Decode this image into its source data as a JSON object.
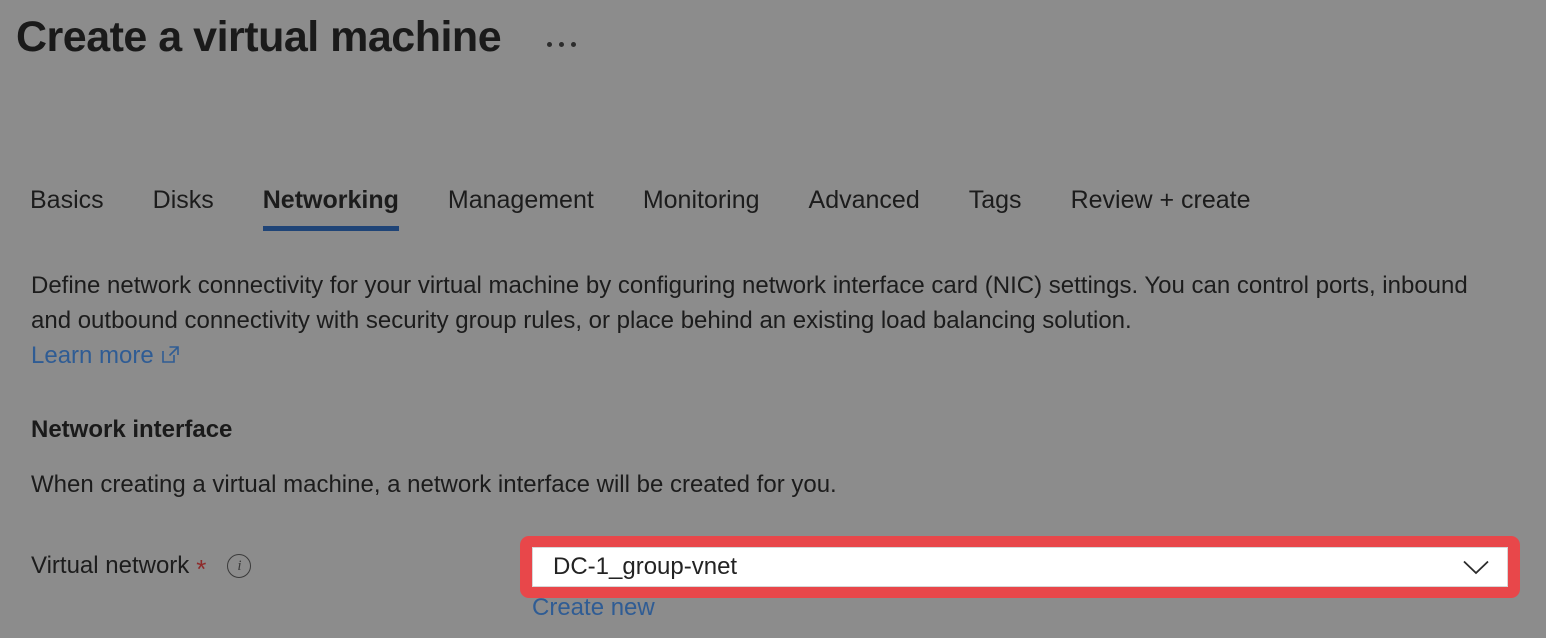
{
  "header": {
    "title": "Create a virtual machine",
    "more_menu": "...",
    "more_menu_name": "more-options-icon"
  },
  "tabs": [
    {
      "label": "Basics",
      "active": false
    },
    {
      "label": "Disks",
      "active": false
    },
    {
      "label": "Networking",
      "active": true
    },
    {
      "label": "Management",
      "active": false
    },
    {
      "label": "Monitoring",
      "active": false
    },
    {
      "label": "Advanced",
      "active": false
    },
    {
      "label": "Tags",
      "active": false
    },
    {
      "label": "Review + create",
      "active": false
    }
  ],
  "intro": {
    "paragraph": "Define network connectivity for your virtual machine by configuring network interface card (NIC) settings. You can control ports, inbound and outbound connectivity with security group rules, or place behind an existing load balancing solution.",
    "learn_more_label": "Learn more",
    "learn_more_icon": "external-link-icon"
  },
  "network_interface": {
    "section_title": "Network interface",
    "description": "When creating a virtual machine, a network interface will be created for you.",
    "virtual_network": {
      "label": "Virtual network",
      "required_marker": "*",
      "info_icon": "i",
      "selected_value": "DC-1_group-vnet",
      "chevron_icon": "chevron-down-icon",
      "create_new_label": "Create new"
    }
  },
  "colors": {
    "page_background": "#8c8c8c",
    "accent_blue": "#2f5c94",
    "active_tab_underline": "#1f4477",
    "highlight_red": "#e8474a",
    "required_asterisk": "#8e2a2a",
    "field_background": "#ffffff"
  }
}
